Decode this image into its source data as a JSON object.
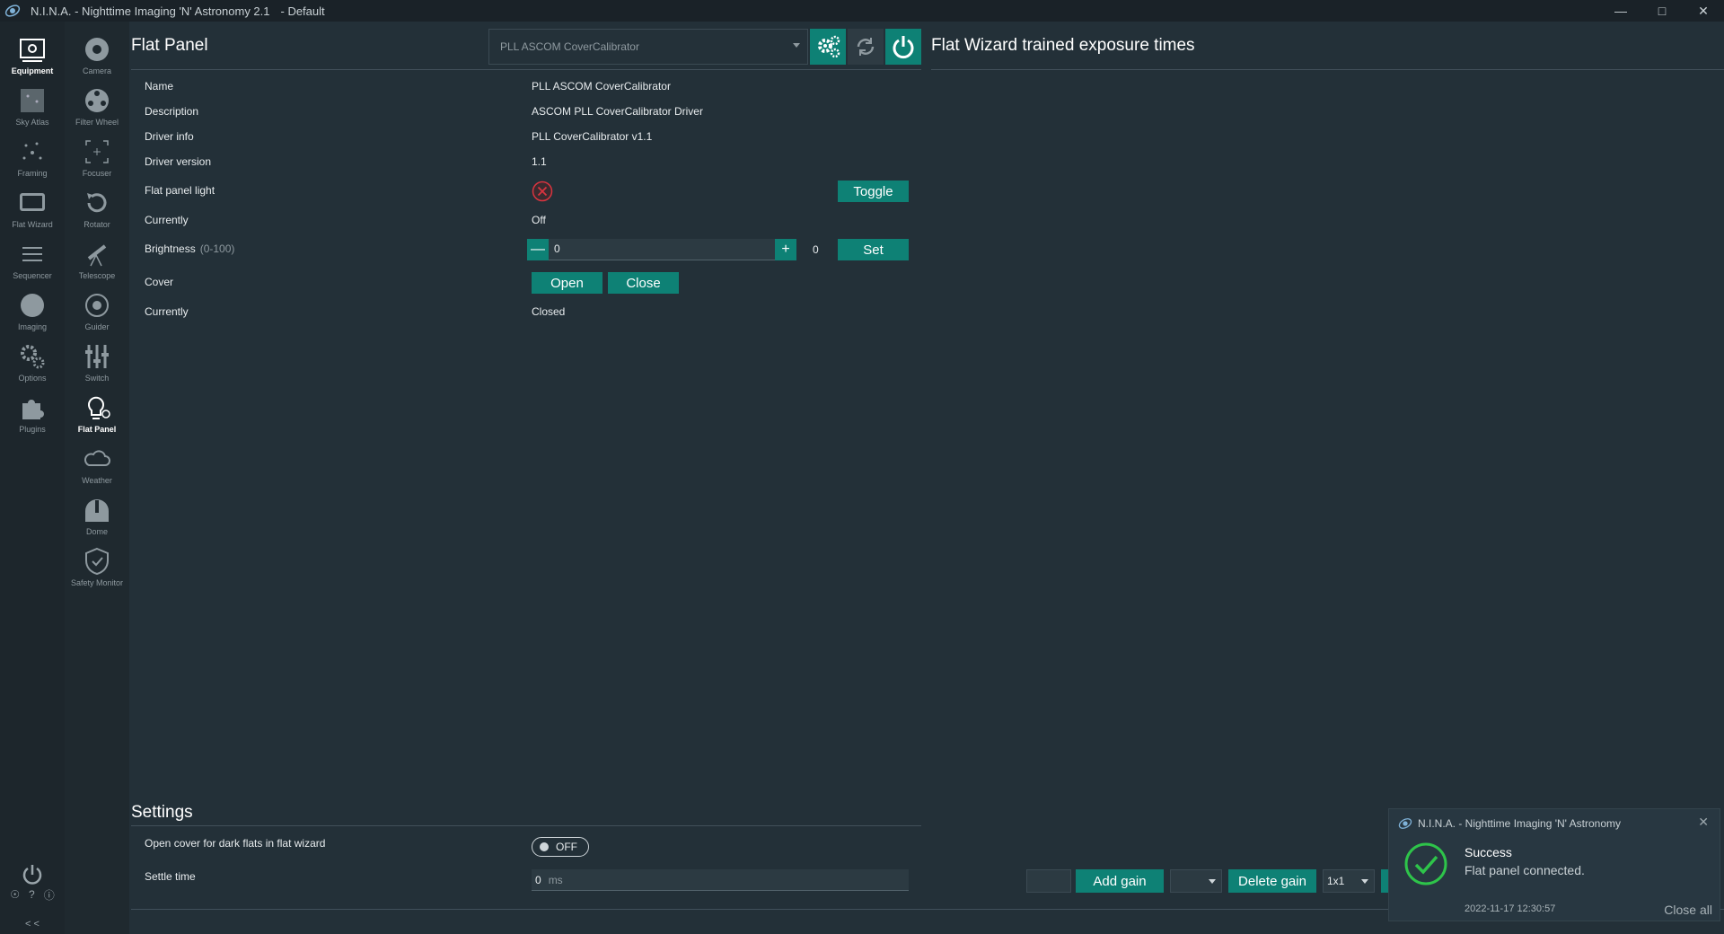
{
  "window": {
    "title": "N.I.N.A. - Nighttime Imaging 'N' Astronomy 2.1",
    "profile": "-  Default"
  },
  "nav_primary": [
    {
      "label": "Equipment",
      "icon": "equipment-icon",
      "active": true
    },
    {
      "label": "Sky Atlas",
      "icon": "sky-atlas-icon"
    },
    {
      "label": "Framing",
      "icon": "framing-icon"
    },
    {
      "label": "Flat Wizard",
      "icon": "flat-wizard-icon"
    },
    {
      "label": "Sequencer",
      "icon": "sequencer-icon"
    },
    {
      "label": "Imaging",
      "icon": "imaging-icon"
    },
    {
      "label": "Options",
      "icon": "options-icon"
    },
    {
      "label": "Plugins",
      "icon": "plugins-icon"
    }
  ],
  "nav_secondary": [
    {
      "label": "Camera",
      "icon": "camera-icon"
    },
    {
      "label": "Filter Wheel",
      "icon": "filter-wheel-icon"
    },
    {
      "label": "Focuser",
      "icon": "focuser-icon"
    },
    {
      "label": "Rotator",
      "icon": "rotator-icon"
    },
    {
      "label": "Telescope",
      "icon": "telescope-icon"
    },
    {
      "label": "Guider",
      "icon": "guider-icon"
    },
    {
      "label": "Switch",
      "icon": "switch-icon"
    },
    {
      "label": "Flat Panel",
      "icon": "flat-panel-icon",
      "active": true
    },
    {
      "label": "Weather",
      "icon": "weather-icon"
    },
    {
      "label": "Dome",
      "icon": "dome-icon"
    },
    {
      "label": "Safety Monitor",
      "icon": "safety-monitor-icon"
    }
  ],
  "nav_footer": {
    "collapse": "< <"
  },
  "panel": {
    "title": "Flat Panel",
    "device_selected": "PLL ASCOM CoverCalibrator"
  },
  "flat_wizard": {
    "title": "Flat Wizard trained exposure times"
  },
  "props": {
    "name_label": "Name",
    "name_value": "PLL ASCOM CoverCalibrator",
    "description_label": "Description",
    "description_value": "ASCOM PLL CoverCalibrator Driver",
    "driver_info_label": "Driver info",
    "driver_info_value": "PLL CoverCalibrator v1.1",
    "driver_version_label": "Driver version",
    "driver_version_value": "1.1",
    "light_label": "Flat panel light",
    "toggle_button": "Toggle",
    "currently_label": "Currently",
    "light_state": "Off",
    "brightness_label": "Brightness",
    "brightness_range": "(0-100)",
    "brightness_input": "0",
    "brightness_current": "0",
    "set_button": "Set",
    "cover_label": "Cover",
    "open_button": "Open",
    "close_button": "Close",
    "cover_currently_label": "Currently",
    "cover_state": "Closed"
  },
  "settings": {
    "title": "Settings",
    "open_cover_label": "Open cover for dark flats in flat wizard",
    "open_cover_toggle": "OFF",
    "settle_label": "Settle time",
    "settle_value": "0",
    "settle_unit": "ms"
  },
  "gain_bar": {
    "add_gain": "Add gain",
    "delete_gain": "Delete gain",
    "binning": "1x1"
  },
  "toast": {
    "header": "N.I.N.A. - Nighttime Imaging 'N' Astronomy",
    "title": "Success",
    "message": "Flat panel connected.",
    "time": "2022-11-17 12:30:57",
    "close_all": "Close all"
  },
  "colors": {
    "accent": "#0e8175",
    "background": "#233038",
    "error": "#d9343f"
  }
}
